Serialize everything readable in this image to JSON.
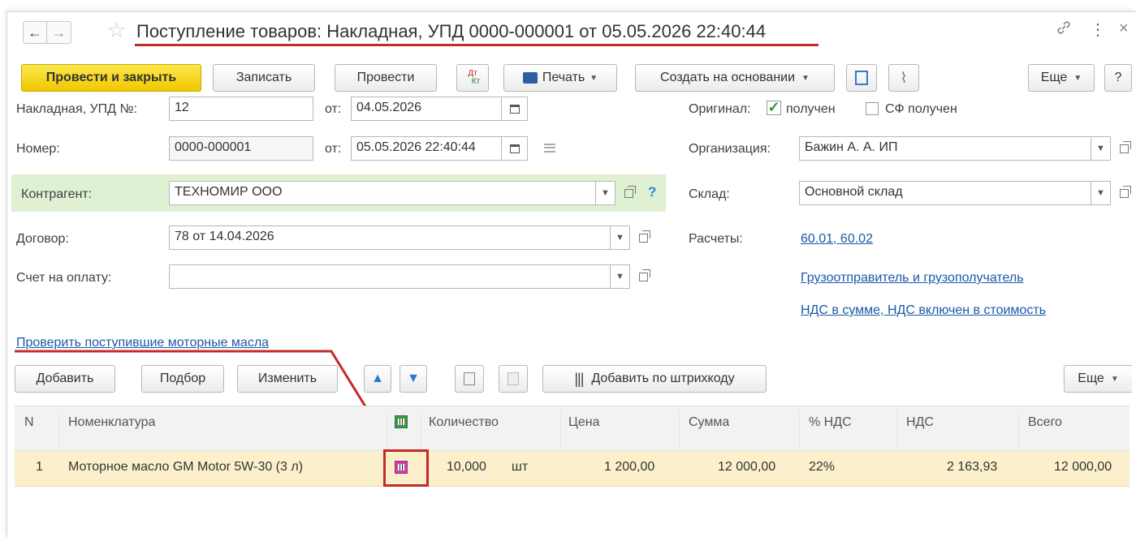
{
  "title": "Поступление товаров: Накладная, УПД 0000-000001 от 05.05.2026 22:40:44",
  "title_bar_icons": {
    "link": "link-icon",
    "more": "⋮",
    "close": "×"
  },
  "toolbar": {
    "post_close": "Провести и закрыть",
    "save": "Записать",
    "post": "Провести",
    "dtkt_top": "Дт",
    "dtkt_bottom": "Кт",
    "print": "Печать",
    "create_based": "Создать на основании",
    "more": "Еще",
    "help": "?"
  },
  "form": {
    "invoice_label": "Накладная, УПД №:",
    "invoice_number": "12",
    "from_label": "от:",
    "invoice_date": "04.05.2026",
    "number_label": "Номер:",
    "number_value": "0000-000001",
    "from_label2": "от:",
    "number_date": "05.05.2026 22:40:44",
    "original_label": "Оригинал:",
    "received_label": "получен",
    "sf_received_label": "СФ получен",
    "org_label": "Организация:",
    "org_value": "Бажин А. А. ИП",
    "counterparty_label": "Контрагент:",
    "counterparty_value": "ТЕХНОМИР ООО",
    "warehouse_label": "Склад:",
    "warehouse_value": "Основной склад",
    "contract_label": "Договор:",
    "contract_value": "78 от 14.04.2026",
    "settlements_label": "Расчеты:",
    "settlements_link": "60.01, 60.02",
    "invoice_pay_label": "Счет на оплату:",
    "invoice_pay_value": "",
    "shipper_link": "Грузоотправитель и грузополучатель",
    "vat_link": "НДС в сумме, НДС включен в стоимость",
    "check_oils_link": "Проверить поступившие моторные масла"
  },
  "table_toolbar": {
    "add": "Добавить",
    "pick": "Подбор",
    "change": "Изменить",
    "add_barcode": "Добавить по штрихкоду",
    "more": "Еще"
  },
  "table": {
    "headers": {
      "n": "N",
      "item": "Номенклатура",
      "qty": "Количество",
      "price": "Цена",
      "sum": "Сумма",
      "vat_pct": "% НДС",
      "vat": "НДС",
      "total": "Всего"
    },
    "rows": [
      {
        "n": "1",
        "item": "Моторное масло GM Motor 5W-30 (3 л)",
        "qty": "10,000",
        "unit": "шт",
        "price": "1 200,00",
        "sum": "12 000,00",
        "vat_pct": "22%",
        "vat": "2 163,93",
        "total": "12 000,00"
      }
    ]
  },
  "colors": {
    "accent_yellow": "#f5d21a",
    "link": "#1a5aa8",
    "highlight_red": "#c42a26",
    "row_selected": "#fbf0cb",
    "counterparty_bg": "#dff0d3"
  }
}
